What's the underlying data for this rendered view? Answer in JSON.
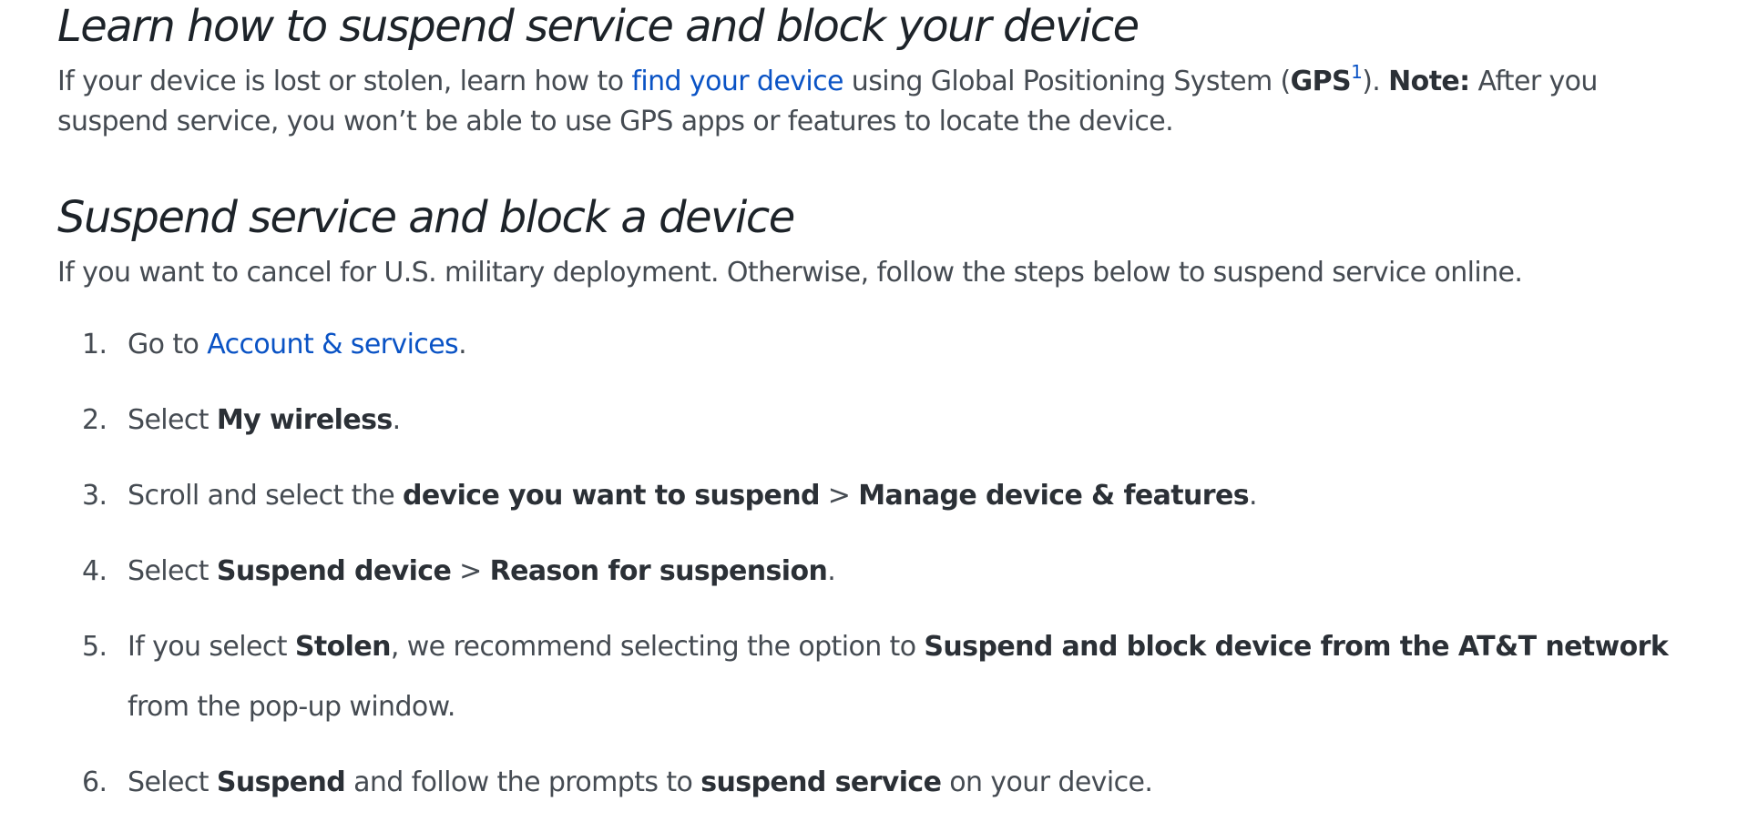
{
  "heading_main": "Learn how to suspend service and block your device",
  "intro": {
    "text1": "If your device is lost or stolen, learn how to ",
    "link": "find your device",
    "text2": " using Global Positioning System (",
    "gps": "GPS",
    "footnote": "1",
    "text3": "). ",
    "note_label": "Note:",
    "text4": " After you suspend service, you won’t be able to use GPS apps or features to locate the device."
  },
  "heading_suspend": "Suspend service and block a device",
  "cancel_text": "If you want to cancel for U.S. military deployment. Otherwise, follow the steps below to suspend service online.",
  "steps": [
    {
      "num": "1.",
      "t1": "Go to ",
      "link": "Account & services",
      "t2": "."
    },
    {
      "num": "2.",
      "t1": "Select ",
      "b1": "My wireless",
      "t2": "."
    },
    {
      "num": "3.",
      "t1": "Scroll and select the ",
      "b1": "device you want to suspend",
      "sep": " > ",
      "b2": "Manage device & features",
      "t2": "."
    },
    {
      "num": "4.",
      "t1": "Select ",
      "b1": "Suspend device",
      "sep": " > ",
      "b2": "Reason for suspension",
      "t2": "."
    },
    {
      "num": "5.",
      "t1": "If you select ",
      "b1": "Stolen",
      "t2": ", we recommend selecting the option to ",
      "b2": "Suspend and block device from the AT&T network",
      "t3": " from the pop-up window."
    },
    {
      "num": "6.",
      "t1": "Select ",
      "b1": "Suspend",
      "t2": " and follow the prompts to ",
      "b2": "suspend service",
      "t3": " on your device."
    }
  ],
  "colors": {
    "link": "#0a53c5",
    "heading": "#1d2329",
    "body_text": "#454b52"
  }
}
